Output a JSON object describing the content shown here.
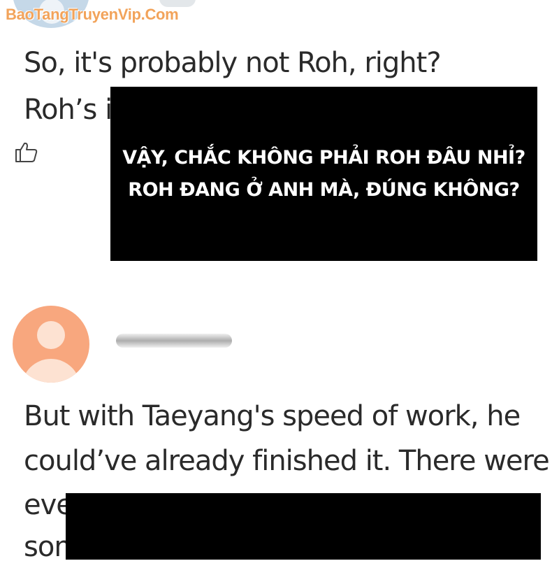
{
  "watermark": "BaoTangTruyenVip.Com",
  "comments": [
    {
      "lines": [
        "So, it's probably not Roh, right?",
        "Roh’s i"
      ],
      "like_icon": "thumbs-up-icon"
    },
    {
      "avatar_icon": "person-icon",
      "lines": [
        "But with Taeyang's speed of work, he",
        "could’ve already finished it. There were",
        "eve",
        "som"
      ]
    }
  ],
  "caption": {
    "lines": [
      "VẬY, CHẮC KHÔNG PHẢI ROH ĐÂU NHỈ?",
      "ROH ĐANG Ở ANH MÀ, ĐÚNG KHÔNG?"
    ]
  },
  "colors": {
    "background": "#ffffff",
    "text": "#2a2a2a",
    "watermark": "#f2a35a",
    "caption_box": "#000000",
    "caption_text": "#ffffff",
    "avatar_top": "#c5d8e8",
    "avatar_peach": "#f8a77e"
  }
}
